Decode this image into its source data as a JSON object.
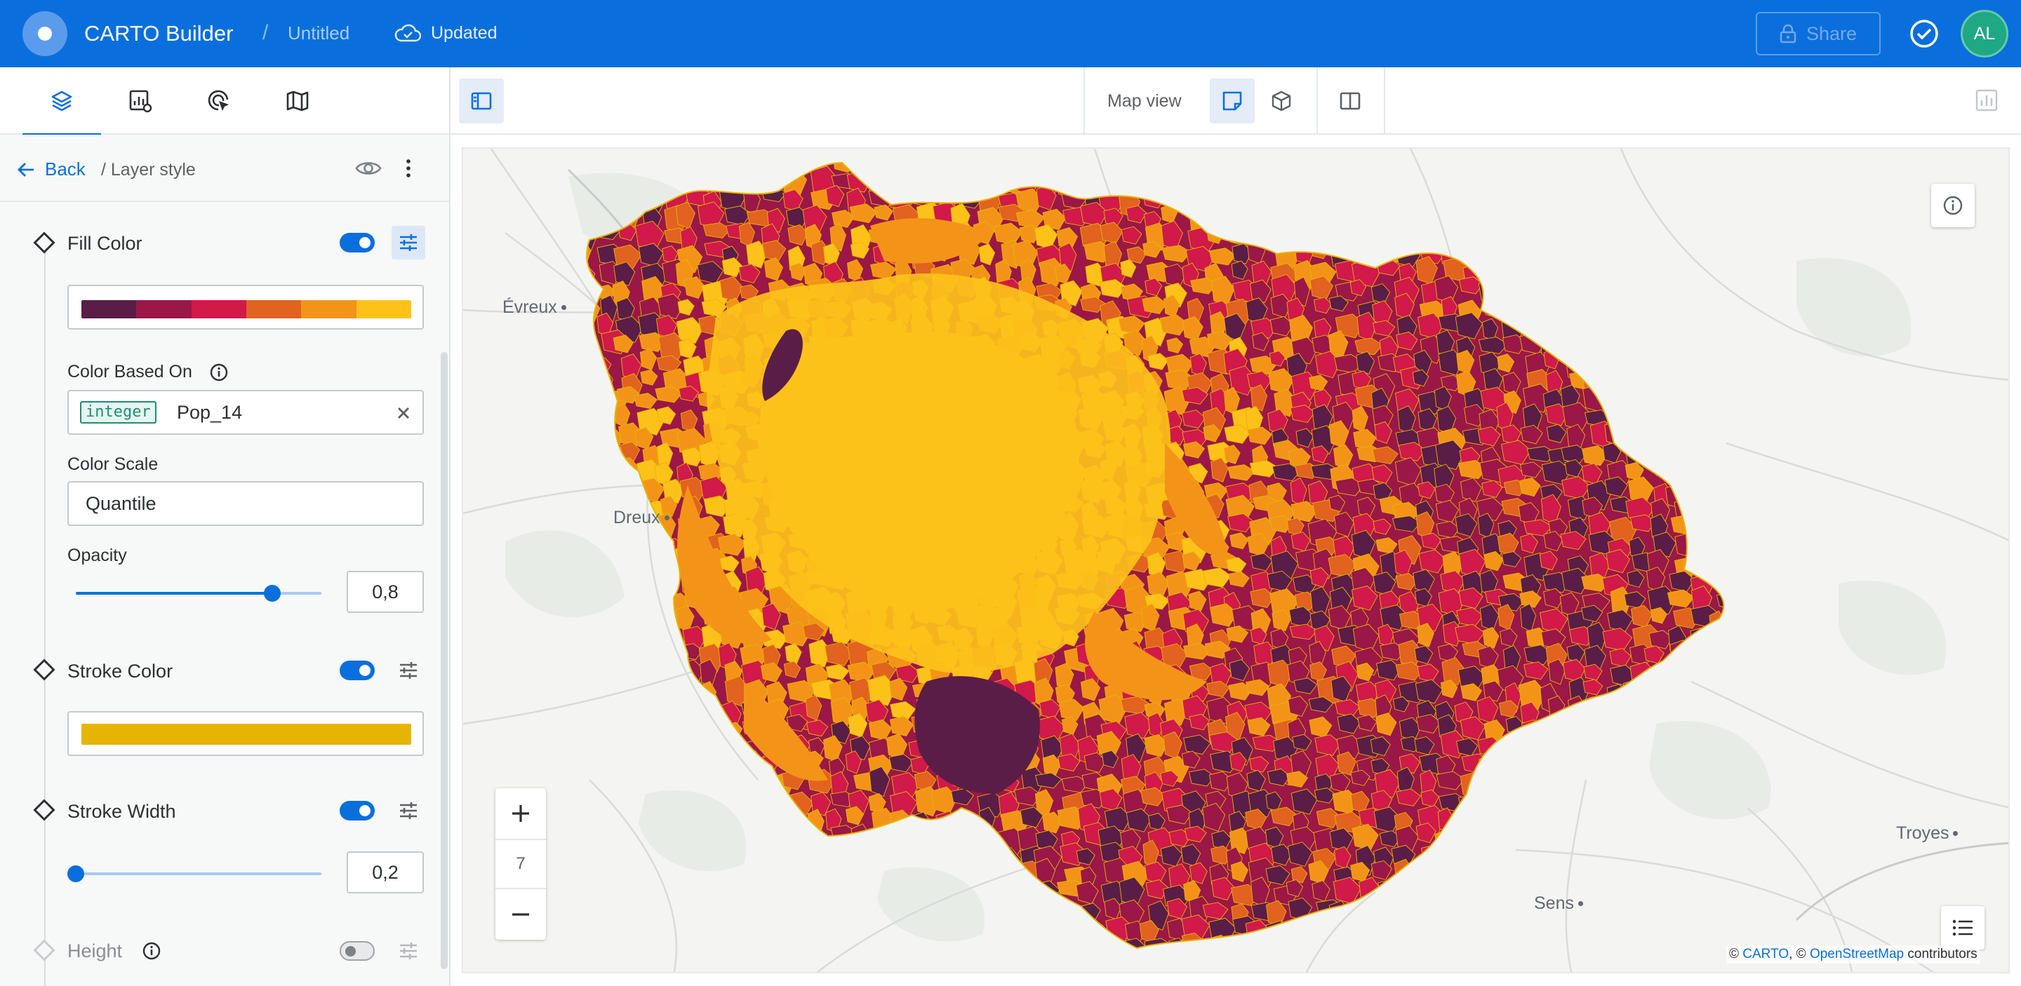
{
  "app": {
    "title": "CARTO Builder",
    "separator": "/",
    "map_name": "Untitled",
    "save_status": "Updated",
    "share_label": "Share",
    "user_initials": "AL"
  },
  "left_tabs": [
    {
      "name": "layers",
      "icon": "layers-icon",
      "active": true
    },
    {
      "name": "widgets",
      "icon": "widgets-settings-icon",
      "active": false
    },
    {
      "name": "interactions",
      "icon": "interactions-icon",
      "active": false
    },
    {
      "name": "basemaps",
      "icon": "map-icon",
      "active": false
    }
  ],
  "breadcrumb": {
    "back_label": "Back",
    "current": "/ Layer style"
  },
  "fill_color": {
    "title": "Fill Color",
    "enabled": true,
    "palette": [
      "#5a1d47",
      "#9b1747",
      "#d1194a",
      "#e2621f",
      "#f39418",
      "#fdc21a"
    ],
    "color_based_on_label": "Color Based On",
    "column_type": "integer",
    "column_name": "Pop_14",
    "color_scale_label": "Color Scale",
    "color_scale_value": "Quantile",
    "opacity_label": "Opacity",
    "opacity_value": "0,8",
    "opacity_fraction": 0.8
  },
  "stroke_color": {
    "title": "Stroke Color",
    "enabled": true,
    "color": "#e6b503"
  },
  "stroke_width": {
    "title": "Stroke Width",
    "enabled": true,
    "value": "0,2",
    "fraction": 0
  },
  "height": {
    "title": "Height",
    "enabled": false
  },
  "map_toolbar": {
    "map_view_label": "Map view"
  },
  "map": {
    "zoom_level": "7",
    "cities": [
      {
        "name": "Évreux"
      },
      {
        "name": "Dreux"
      },
      {
        "name": "Troyes"
      },
      {
        "name": "Sens"
      }
    ],
    "attribution": {
      "prefix": "© ",
      "carto": "CARTO",
      "middle": ", © ",
      "osm": "OpenStreetMap",
      "suffix": " contributors"
    }
  },
  "colors": {
    "brand": "#0a6fdc",
    "avatar": "#1ea884"
  }
}
